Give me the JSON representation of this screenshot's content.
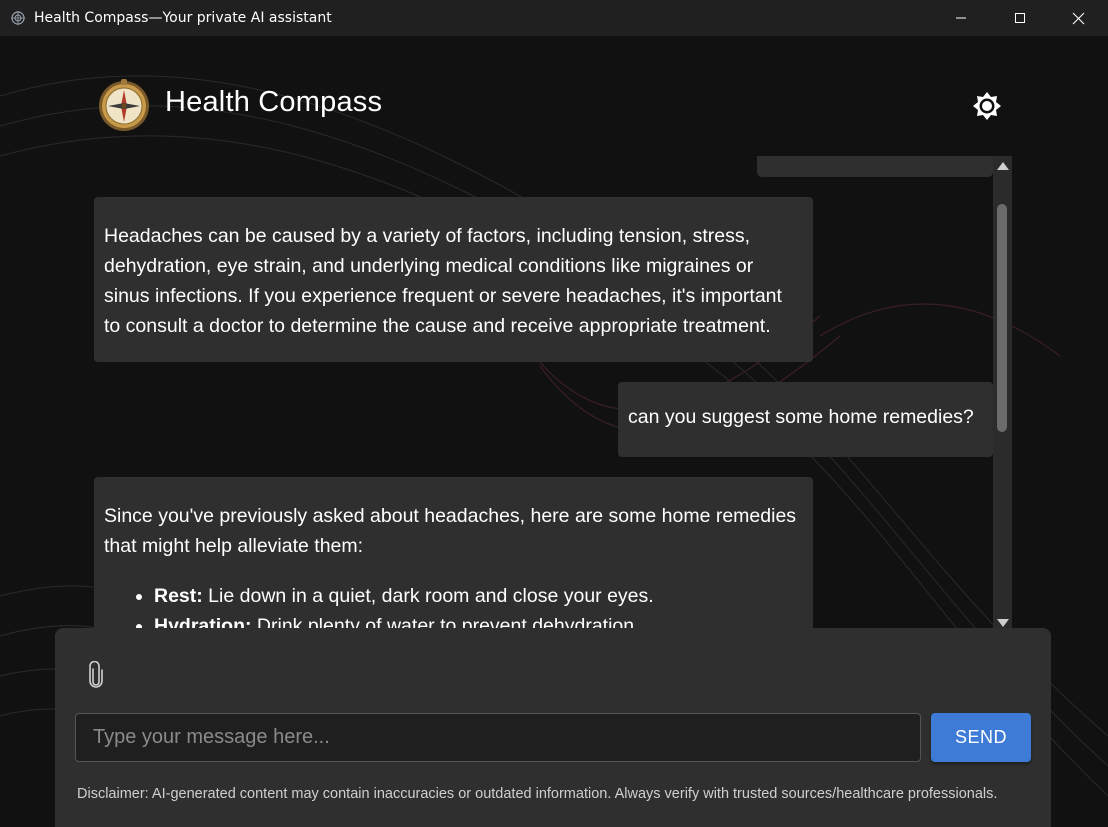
{
  "window": {
    "title": "Health Compass—Your private AI assistant",
    "controls": [
      "minimize-icon",
      "maximize-icon",
      "close-icon"
    ]
  },
  "header": {
    "app_name": "Health Compass",
    "logo_icon": "compass-logo-icon",
    "theme_toggle_icon": "brightness-icon"
  },
  "messages": [
    {
      "role": "assistant",
      "text": "Headaches can be caused by a variety of factors, including tension, stress, dehydration, eye strain, and underlying medical conditions like migraines or sinus infections. If you experience frequent or severe headaches, it's important to consult a doctor to determine the cause and receive appropriate treatment."
    },
    {
      "role": "user",
      "text": "can you suggest some home remedies?"
    },
    {
      "role": "assistant",
      "text": "Since you've previously asked about headaches, here are some home remedies that might help alleviate them:",
      "list": [
        {
          "term": "Rest:",
          "desc": " Lie down in a quiet, dark room and close your eyes."
        },
        {
          "term": "Hydration:",
          "desc": " Drink plenty of water to prevent dehydration."
        }
      ]
    }
  ],
  "composer": {
    "attach_icon": "paperclip-icon",
    "placeholder": "Type your message here...",
    "value": "",
    "send_label": "SEND",
    "disclaimer": "Disclaimer: AI-generated content may contain inaccuracies or outdated information. Always verify with trusted sources/healthcare professionals."
  },
  "colors": {
    "background": "#111111",
    "bubble": "#2f2f2f",
    "accent": "#3d7bd6",
    "titlebar": "#202020"
  }
}
